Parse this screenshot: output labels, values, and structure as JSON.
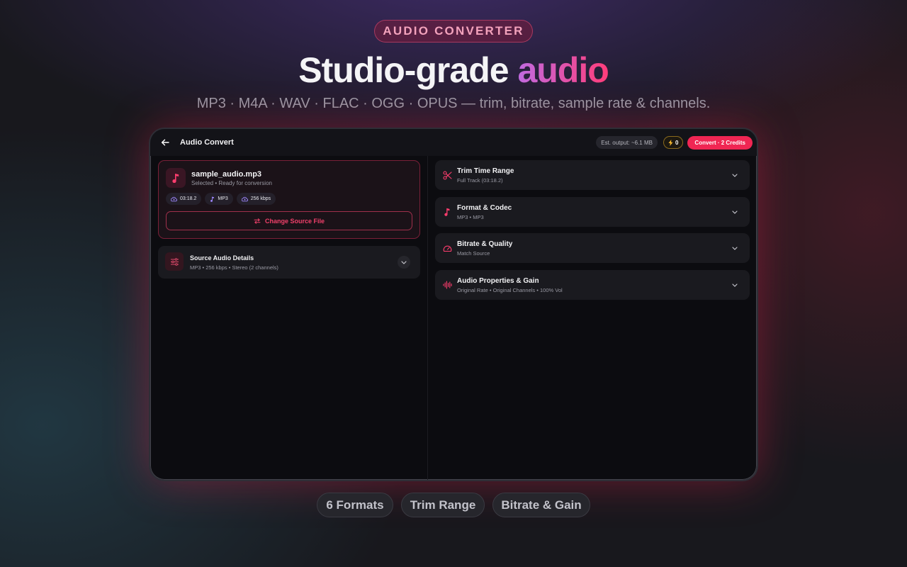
{
  "hero": {
    "badge": "AUDIO CONVERTER",
    "title_main": "Studio-grade",
    "title_accent": "audio",
    "subtitle": "MP3 · M4A · WAV · FLAC · OGG · OPUS — trim, bitrate, sample rate & channels."
  },
  "appbar": {
    "title": "Audio Convert",
    "est_output": "Est. output: ~6.1 MB",
    "credits": "0",
    "convert_label": "Convert · 2 Credits"
  },
  "file": {
    "name": "sample_audio.mp3",
    "status": "Selected • Ready for conversion",
    "chips": [
      "03:18.2",
      "MP3",
      "256 kbps"
    ],
    "change_label": "Change Source File"
  },
  "source_details": {
    "title": "Source Audio Details",
    "subtitle": "MP3 • 256 kbps • Stereo (2 channels)"
  },
  "settings": [
    {
      "title": "Trim Time Range",
      "subtitle": "Full Track (03:18.2)",
      "icon": "scissors-icon"
    },
    {
      "title": "Format & Codec",
      "subtitle": "MP3 • MP3",
      "icon": "music-note-icon"
    },
    {
      "title": "Bitrate & Quality",
      "subtitle": "Match Source",
      "icon": "gauge-icon"
    },
    {
      "title": "Audio Properties & Gain",
      "subtitle": "Original Rate • Original Channels • 100% Vol",
      "icon": "waveform-icon"
    }
  ],
  "features": [
    "6 Formats",
    "Trim Range",
    "Bitrate & Gain"
  ],
  "colors": {
    "accent": "#f02653",
    "accent_soft": "#f3a2bc",
    "background": "#18181d",
    "panel": "#1a1a1f",
    "credits_border": "#8a6a1c"
  }
}
